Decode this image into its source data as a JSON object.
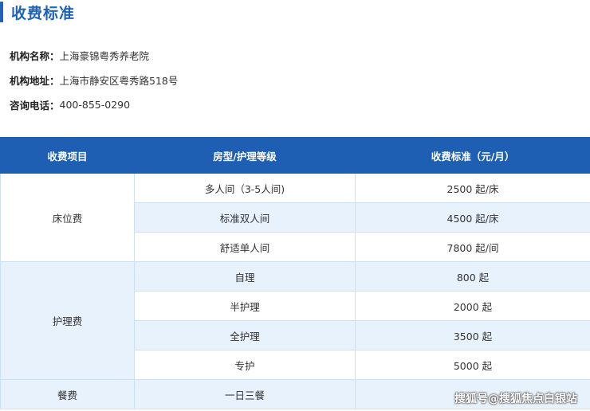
{
  "section": {
    "title": "收费标准"
  },
  "info": {
    "name_label": "机构名称：",
    "name_value": "上海豪锦粤秀养老院",
    "address_label": "机构地址：",
    "address_value": "上海市静安区粤秀路518号",
    "phone_label": "咨询电话：",
    "phone_value": "400-855-0290"
  },
  "table": {
    "headers": [
      "收费项目",
      "房型/护理等级",
      "收费标准（元/月）"
    ],
    "groups": [
      {
        "item": "床位费",
        "rows": [
          {
            "level": "多人间（3-5人间)",
            "price": "2500 起/床"
          },
          {
            "level": "标准双人间",
            "price": "4500 起/床"
          },
          {
            "level": "舒适单人间",
            "price": "7800 起/间"
          }
        ]
      },
      {
        "item": "护理费",
        "rows": [
          {
            "level": "自理",
            "price": "800 起"
          },
          {
            "level": "半护理",
            "price": "2000 起"
          },
          {
            "level": "全护理",
            "price": "3500 起"
          },
          {
            "level": "专护",
            "price": "5000 起"
          }
        ]
      },
      {
        "item": "餐费",
        "rows": [
          {
            "level": "一日三餐",
            "price": ""
          }
        ]
      }
    ]
  },
  "watermark": "搜狐号@搜狐焦点白银站"
}
